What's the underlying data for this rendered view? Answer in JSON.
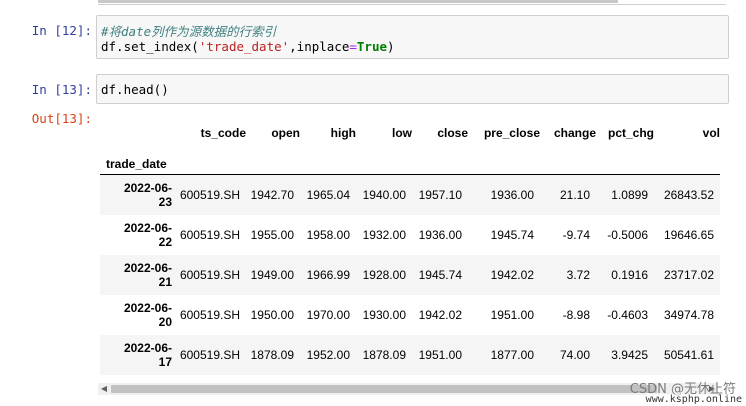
{
  "cells": [
    {
      "prompt": "In  [12]:",
      "lines": [
        {
          "comment": "#将date列作为源数据的行索引"
        },
        {
          "pre": "df.set_index(",
          "str": "'trade_date'",
          "mid": ",inplace",
          "op": "=",
          "kw": "True",
          "post": ")"
        }
      ]
    },
    {
      "prompt": "In  [13]:",
      "code": "df.head()"
    }
  ],
  "output": {
    "prompt": "Out[13]:",
    "table": {
      "columns": [
        "ts_code",
        "open",
        "high",
        "low",
        "close",
        "pre_close",
        "change",
        "pct_chg",
        "vol"
      ],
      "index_name": "trade_date",
      "rows": [
        {
          "idx1": "2022-06-",
          "idx2": "23",
          "vals": [
            "600519.SH",
            "1942.70",
            "1965.04",
            "1940.00",
            "1957.10",
            "1936.00",
            "21.10",
            "1.0899",
            "26843.52"
          ]
        },
        {
          "idx1": "2022-06-",
          "idx2": "22",
          "vals": [
            "600519.SH",
            "1955.00",
            "1958.00",
            "1932.00",
            "1936.00",
            "1945.74",
            "-9.74",
            "-0.5006",
            "19646.65"
          ]
        },
        {
          "idx1": "2022-06-",
          "idx2": "21",
          "vals": [
            "600519.SH",
            "1949.00",
            "1966.99",
            "1928.00",
            "1945.74",
            "1942.02",
            "3.72",
            "0.1916",
            "23717.02"
          ]
        },
        {
          "idx1": "2022-06-",
          "idx2": "20",
          "vals": [
            "600519.SH",
            "1950.00",
            "1970.00",
            "1930.00",
            "1942.02",
            "1951.00",
            "-8.98",
            "-0.4603",
            "34974.78"
          ]
        },
        {
          "idx1": "2022-06-",
          "idx2": "17",
          "vals": [
            "600519.SH",
            "1878.09",
            "1952.00",
            "1878.09",
            "1951.00",
            "1877.00",
            "74.00",
            "3.9425",
            "50541.61"
          ]
        }
      ]
    }
  },
  "scrollbar": {
    "left_arrow": "◀",
    "right_arrow": "▶"
  },
  "watermark": "CSDN @无休止符",
  "watermark_url": "www.ksphp.online"
}
